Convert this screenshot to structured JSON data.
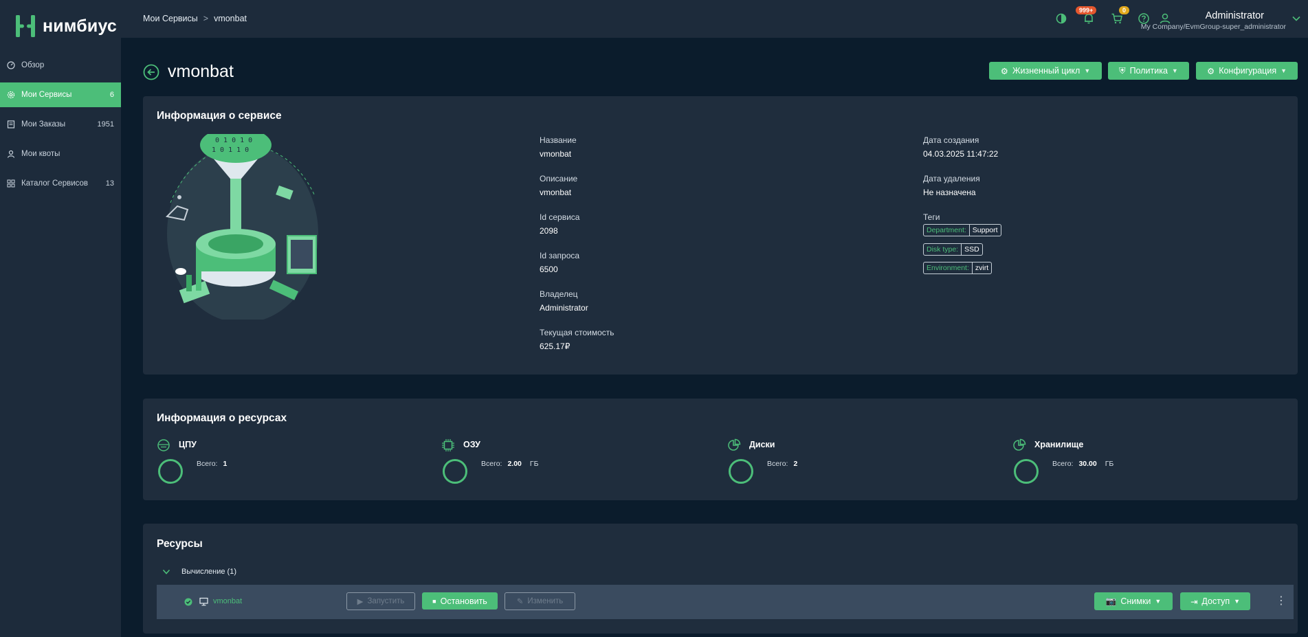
{
  "app": {
    "logo_text": "нимбиус"
  },
  "sidebar": {
    "items": [
      {
        "label": "Обзор",
        "count": ""
      },
      {
        "label": "Мои Сервисы",
        "count": "6"
      },
      {
        "label": "Мои Заказы",
        "count": "1951"
      },
      {
        "label": "Мои квоты",
        "count": ""
      },
      {
        "label": "Каталог Сервисов",
        "count": "13"
      }
    ]
  },
  "topbar": {
    "breadcrumb": [
      "Мои Сервисы",
      "vmonbat"
    ],
    "notifications_badge": "999+",
    "cart_badge": "0",
    "user_name": "Administrator",
    "user_org": "My Company/EvmGroup-super_administrator"
  },
  "page": {
    "title": "vmonbat",
    "actions": [
      "Жизненный цикл",
      "Политика",
      "Конфигурация"
    ]
  },
  "service_info": {
    "title": "Информация о сервисе",
    "left_fields": [
      {
        "label": "Название",
        "value": "vmonbat"
      },
      {
        "label": "Описание",
        "value": "vmonbat"
      },
      {
        "label": "Id сервиса",
        "value": "2098"
      },
      {
        "label": "Id запроса",
        "value": "6500"
      },
      {
        "label": "Владелец",
        "value": "Administrator"
      },
      {
        "label": "Текущая стоимость",
        "value": "625.17₽"
      }
    ],
    "right_fields": [
      {
        "label": "Дата создания",
        "value": "04.03.2025 11:47:22"
      },
      {
        "label": "Дата удаления",
        "value": "Не назначена"
      }
    ],
    "tags_label": "Теги",
    "tags": [
      {
        "key": "Department:",
        "value": "Support"
      },
      {
        "key": "Disk type:",
        "value": "SSD"
      },
      {
        "key": "Environment:",
        "value": "zvirt"
      }
    ]
  },
  "resources_info": {
    "title": "Информация о ресурсах",
    "total_label": "Всего:",
    "items": [
      {
        "name": "ЦПУ",
        "total": "1",
        "unit": ""
      },
      {
        "name": "ОЗУ",
        "total": "2.00",
        "unit": "ГБ"
      },
      {
        "name": "Диски",
        "total": "2",
        "unit": ""
      },
      {
        "name": "Хранилище",
        "total": "30.00",
        "unit": "ГБ"
      }
    ]
  },
  "resources": {
    "title": "Ресурсы",
    "group_label": "Вычисление (1)",
    "row": {
      "name": "vmonbat",
      "start_label": "Запустить",
      "stop_label": "Остановить",
      "change_label": "Изменить",
      "snapshots_label": "Снимки",
      "access_label": "Доступ"
    }
  }
}
